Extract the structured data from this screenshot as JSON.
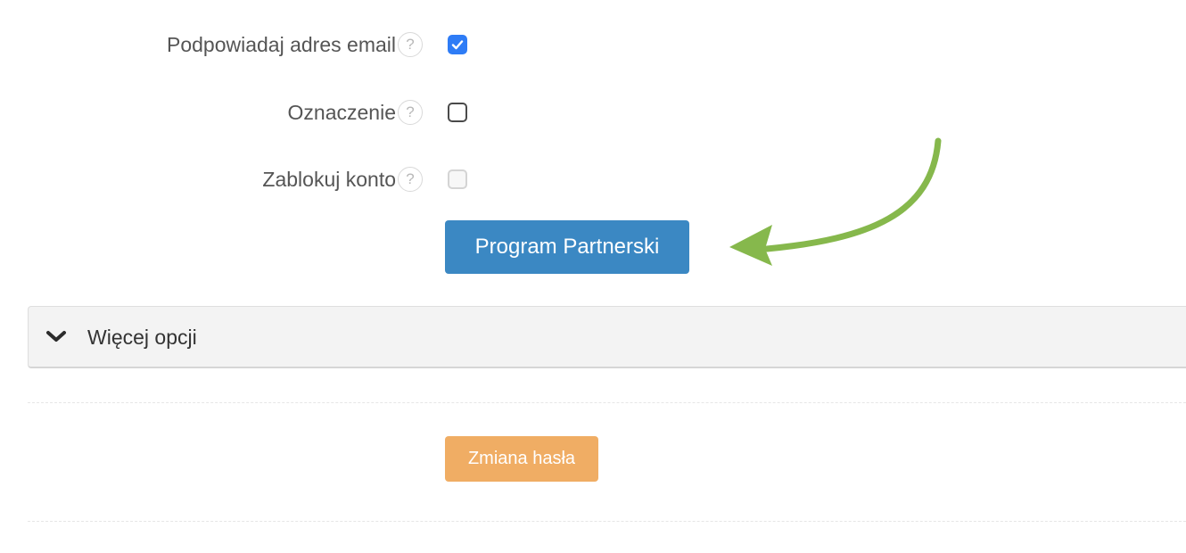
{
  "settings": {
    "rows": [
      {
        "label": "Podpowiadaj adres email",
        "help": "?",
        "checked": true,
        "disabled": false
      },
      {
        "label": "Oznaczenie",
        "help": "?",
        "checked": false,
        "disabled": false
      },
      {
        "label": "Zablokuj konto",
        "help": "?",
        "checked": false,
        "disabled": true
      }
    ]
  },
  "buttons": {
    "partner_program": "Program Partnerski",
    "change_password": "Zmiana hasła"
  },
  "more_options": {
    "label": "Więcej opcji"
  },
  "colors": {
    "checkbox_checked": "#2e7cf6",
    "partner_button": "#3b88c3",
    "password_button": "#f0ad64",
    "annotation_arrow": "#86b84c"
  },
  "icons": {
    "help": "question-mark-circle",
    "checkmark": "check",
    "expand": "chevron-down",
    "annotation": "curved-arrow"
  }
}
